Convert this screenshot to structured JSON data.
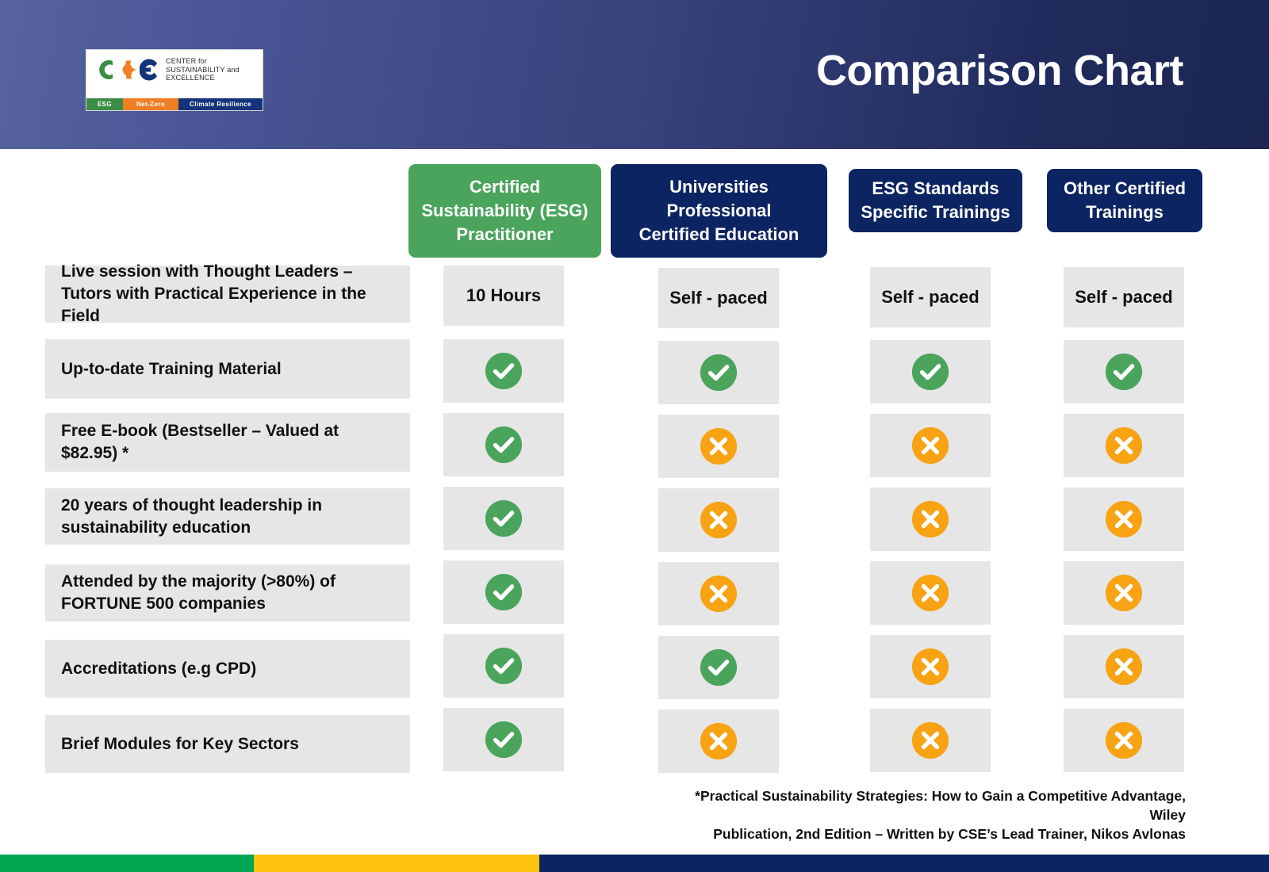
{
  "header": {
    "title": "Comparison Chart",
    "logo": {
      "mark_letters": "CSE",
      "name_line1": "CENTER for",
      "name_line2": "SUSTAINABILITY and",
      "name_line3": "EXCELLENCE",
      "strip": [
        "ESG",
        "Net-Zero",
        "Climate Resilience"
      ],
      "colors": {
        "c": "#3b8c45",
        "s": "#ef7f22",
        "e": "#14337a"
      }
    },
    "gradient_from": "#56639f",
    "gradient_to": "#1b2550"
  },
  "columns": [
    {
      "label": "Certified\nSustainability (ESG)\nPractitioner",
      "lines": [
        "Certified",
        "Sustainability (ESG)",
        "Practitioner"
      ],
      "style": "green",
      "color": "#4aa45c"
    },
    {
      "label": "Universities\nProfessional\nCertified Education",
      "lines": [
        "Universities",
        "Professional",
        "Certified Education"
      ],
      "style": "navy",
      "color": "#0c2461"
    },
    {
      "label": "ESG Standards\nSpecific Trainings",
      "lines": [
        "ESG Standards",
        "Specific Trainings"
      ],
      "style": "navy",
      "color": "#0c2461"
    },
    {
      "label": "Other Certified\nTrainings",
      "lines": [
        "Other Certified",
        "Trainings"
      ],
      "style": "navy",
      "color": "#0c2461"
    }
  ],
  "rows": [
    {
      "label": "Live session with Thought Leaders – Tutors with Practical Experience in the Field",
      "values": [
        "10 Hours",
        "Self - paced",
        "Self - paced",
        "Self - paced"
      ],
      "kinds": [
        "text",
        "text",
        "text",
        "text"
      ]
    },
    {
      "label": "Up-to-date Training Material",
      "values": [
        "check",
        "check",
        "check",
        "check"
      ],
      "kinds": [
        "icon",
        "icon",
        "icon",
        "icon"
      ]
    },
    {
      "label": "Free E-book (Bestseller – Valued at $82.95) *",
      "values": [
        "check",
        "cross",
        "cross",
        "cross"
      ],
      "kinds": [
        "icon",
        "icon",
        "icon",
        "icon"
      ]
    },
    {
      "label": "20 years of thought leadership in sustainability education",
      "values": [
        "check",
        "cross",
        "cross",
        "cross"
      ],
      "kinds": [
        "icon",
        "icon",
        "icon",
        "icon"
      ]
    },
    {
      "label": "Attended by the majority (>80%) of FORTUNE 500 companies",
      "values": [
        "check",
        "cross",
        "cross",
        "cross"
      ],
      "kinds": [
        "icon",
        "icon",
        "icon",
        "icon"
      ]
    },
    {
      "label": "Accreditations (e.g CPD)",
      "values": [
        "check",
        "check",
        "cross",
        "cross"
      ],
      "kinds": [
        "icon",
        "icon",
        "icon",
        "icon"
      ]
    },
    {
      "label": "Brief Modules for Key Sectors",
      "values": [
        "check",
        "cross",
        "cross",
        "cross"
      ],
      "kinds": [
        "icon",
        "icon",
        "icon",
        "icon"
      ]
    }
  ],
  "footnote": {
    "line1": "*Practical Sustainability Strategies: How to Gain a Competitive Advantage, Wiley",
    "line2": "Publication, 2nd Edition – Written by CSE’s Lead Trainer, Nikos Avlonas"
  },
  "footer_bar": {
    "segments": [
      "green",
      "yellow",
      "navy"
    ],
    "colors": [
      "#00a651",
      "#ffc20e",
      "#0c2461"
    ]
  },
  "icon_colors": {
    "check": "#4aa45c",
    "cross": "#f7a313"
  }
}
